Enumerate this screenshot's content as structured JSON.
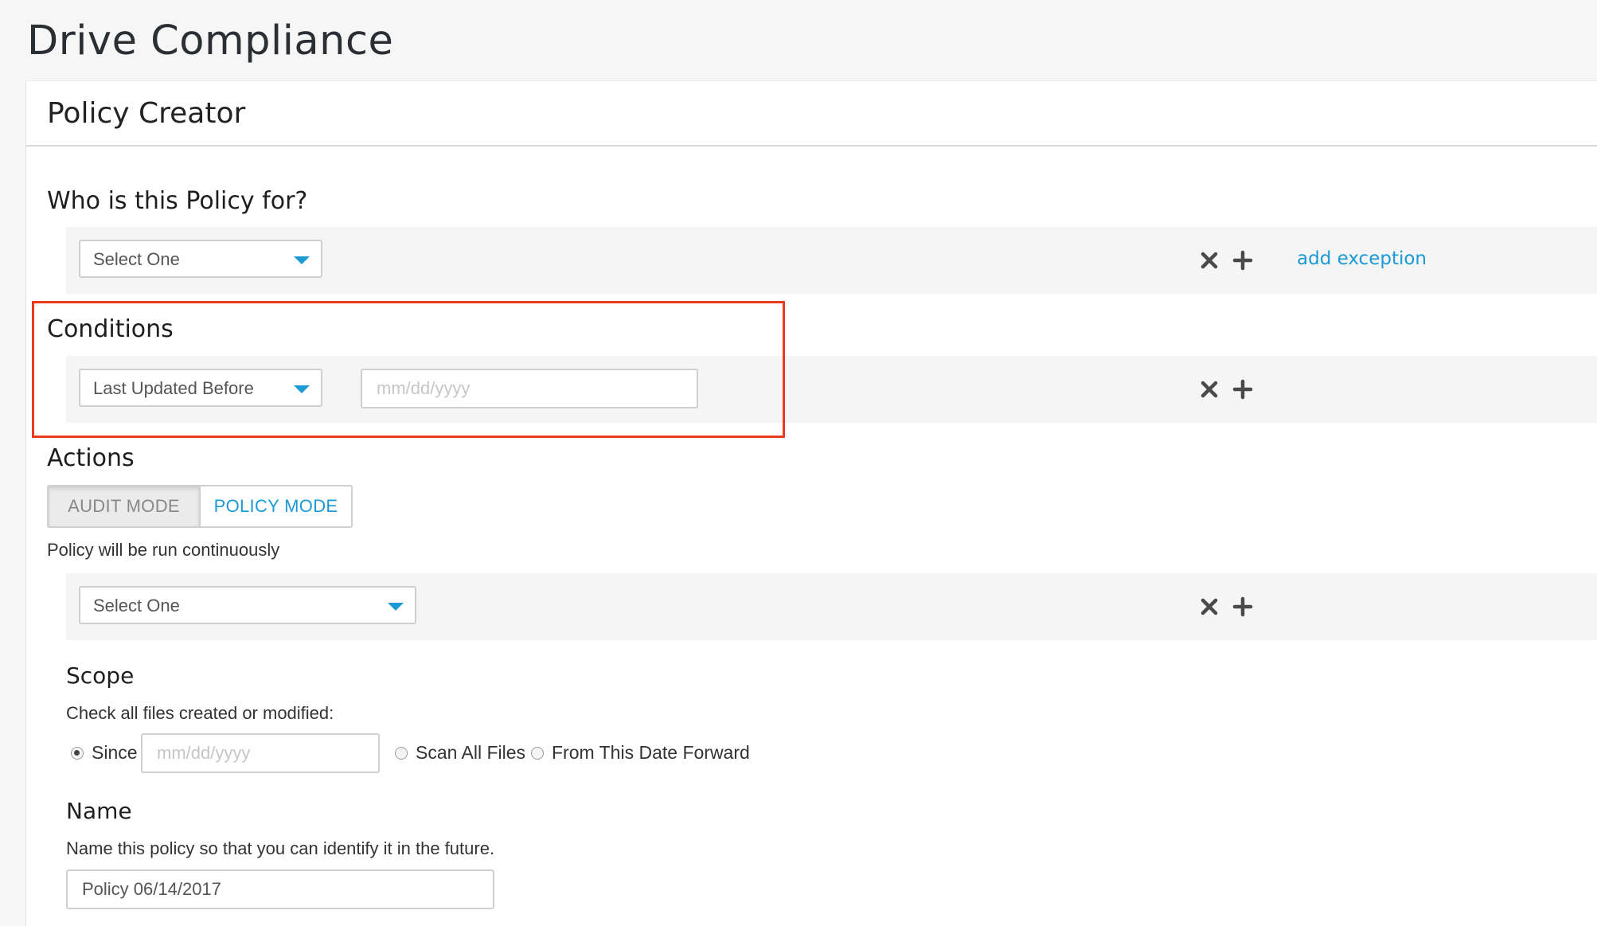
{
  "page": {
    "title": "Drive Compliance"
  },
  "panel": {
    "title": "Policy Creator"
  },
  "who": {
    "label": "Who is this Policy for?",
    "select_value": "Select One",
    "add_exception_label": "add exception"
  },
  "conditions": {
    "label": "Conditions",
    "select_value": "Last Updated Before",
    "date_placeholder": "mm/dd/yyyy"
  },
  "actions": {
    "label": "Actions",
    "modes": [
      "AUDIT MODE",
      "POLICY MODE"
    ],
    "selected_mode": "POLICY MODE",
    "mode_description": "Policy will be run continuously",
    "select_value": "Select One"
  },
  "scope": {
    "label": "Scope",
    "description": "Check all files created or modified:",
    "options": [
      "Since",
      "Scan All Files",
      "From This Date Forward"
    ],
    "selected_option": "Since",
    "since_placeholder": "mm/dd/yyyy"
  },
  "name": {
    "label": "Name",
    "description": "Name this policy so that you can identify it in the future.",
    "value": "Policy 06/14/2017"
  },
  "icons": {
    "remove": "close-icon",
    "add": "plus-icon",
    "dropdown": "caret-down-icon"
  },
  "colors": {
    "accent": "#1b9ad6",
    "highlight": "#ea3b1f",
    "row_background": "#f5f5f5"
  }
}
